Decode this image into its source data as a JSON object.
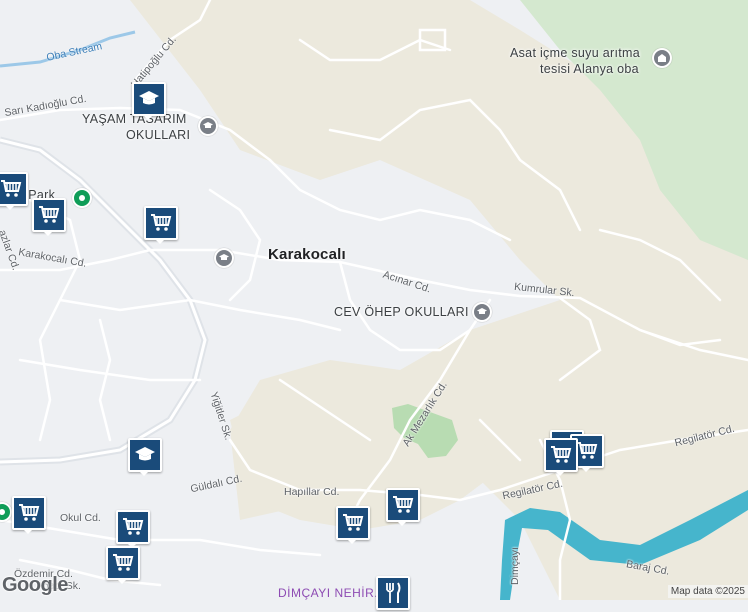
{
  "map": {
    "colors": {
      "background": "#eef0f3",
      "terrain": "#ece9dd",
      "forest": "#d4e8cf",
      "park": "#b8dcb2",
      "water": "#9cc8e8",
      "river": "#46b5cc",
      "road": "#ffffff",
      "highway": "#dfe3e8",
      "shop_pin": "#1a4b7a",
      "school_pin": "#1a4b7a",
      "recreation_pin": "#0f9d58"
    },
    "place_label": "Karakocalı",
    "poi_labels": {
      "yasam": "YAŞAM TASARIM OKULLARI",
      "yasam_line1": "YAŞAM TASARIM",
      "yasam_line2": "OKULLARI",
      "cev": "CEV ÖHEP OKULLARI",
      "asat_line1": "Asat içme suyu arıtma",
      "asat_line2": "tesisi Alanya oba",
      "park_partial": "no Park",
      "dimcayi": "DİMÇAYI NEHİR..."
    },
    "streets": {
      "oba_stream": "Oba Stream",
      "hatipoglu": "Hatipoğlu Cd.",
      "sari_kadioglu": "Sarı Kadıoğlu Cd.",
      "karakocali": "Karakocalı Cd.",
      "acinar": "Acınar Cd.",
      "kumrular": "Kumrular Sk.",
      "ak_mezarlik": "Ak Mezarlık Cd.",
      "yigitler": "Yiğitler Sk.",
      "guldali": "Güldalı Cd.",
      "hapillar": "Hapıllar Cd.",
      "regilator1": "Regilatör Cd.",
      "regilator2": "Regilatör Cd.",
      "baraj": "Baraj Cd.",
      "dimcayi": "Dimçayı",
      "okul": "Okul Cd.",
      "ozdemir": "Özdemir Cd.",
      "agaci": "Ağacı Sk.",
      "left_vertical": "...azlar Cd."
    },
    "icons": {
      "shop": "shopping-cart-icon",
      "school": "graduation-cap-icon",
      "restaurant": "fork-knife-icon",
      "recreation": "park-icon"
    },
    "attribution": {
      "logo": "Google",
      "credit": "Map data ©2025"
    }
  }
}
